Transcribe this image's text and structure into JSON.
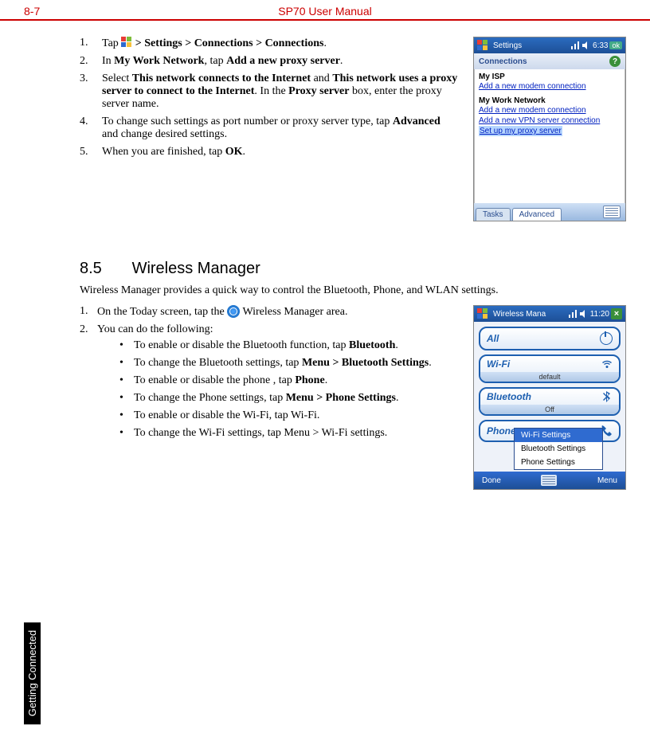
{
  "header": {
    "left": "8-7",
    "center": "SP70 User Manual"
  },
  "side_tab": "Getting Connected",
  "proxy_steps": {
    "s1a": "Tap ",
    "s1b": " > Settings > Connections > Connections",
    "s2a": "In ",
    "s2b": "My Work Network",
    "s2c": ", tap ",
    "s2d": "Add a new proxy server",
    "s3a": "Select ",
    "s3b": "This network connects to the Internet",
    "s3c": " and ",
    "s3d": "This network uses a proxy server to connect to the Internet",
    "s3e": ". In the ",
    "s3f": "Proxy server",
    "s3g": " box, enter the proxy server name.",
    "s4a": "To change such settings as port number or proxy server type, tap ",
    "s4b": "Advanced",
    "s4c": " and change desired settings.",
    "s5a": "When you are finished, tap ",
    "s5b": "OK"
  },
  "section": {
    "num": "8.5",
    "title": "Wireless Manager",
    "intro": "Wireless Manager provides a quick way to control the Bluetooth, Phone, and WLAN settings."
  },
  "wm_steps": {
    "s1a": "On the Today screen, tap the ",
    "s1b": " Wireless Manager area.",
    "s2": "You can do the following:",
    "b1a": "To enable or disable the Bluetooth function, tap ",
    "b1b": "Bluetooth",
    "b2a": "To change the Bluetooth settings, tap ",
    "b2b": "Menu > Bluetooth Settings",
    "b3a": "To enable or disable the phone , tap ",
    "b3b": "Phone",
    "b4a": "To change the Phone settings, tap ",
    "b4b": "Menu > Phone Settings",
    "b5": "To enable or disable the Wi-Fi, tap Wi-Fi.",
    "b6": "To change the Wi-Fi settings, tap Menu > Wi-Fi settings."
  },
  "shot1": {
    "title": "Settings",
    "time": "6:33",
    "ok": "ok",
    "sub": "Connections",
    "grp1": "My ISP",
    "l1": "Add a new modem connection",
    "grp2": "My Work Network",
    "l2": "Add a new modem connection",
    "l3": "Add a new VPN server connection",
    "l4": "Set up my proxy server",
    "tab1": "Tasks",
    "tab2": "Advanced"
  },
  "shot2": {
    "title": "Wireless Mana",
    "time": "11:20",
    "all": "All",
    "wifi": "Wi-Fi",
    "wifi_sub": "default",
    "bt": "Bluetooth",
    "bt_sub": "Off",
    "phone": "Phone",
    "m1": "Wi-Fi Settings",
    "m2": "Bluetooth Settings",
    "m3": "Phone Settings",
    "done": "Done",
    "menu": "Menu"
  }
}
